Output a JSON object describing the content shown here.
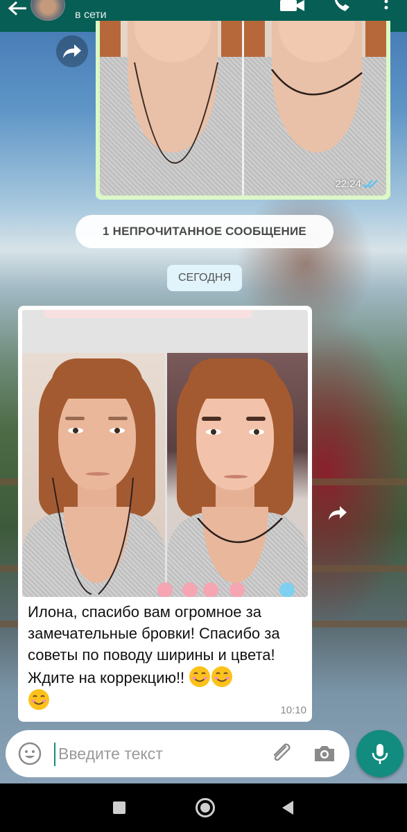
{
  "header": {
    "status": "в сети"
  },
  "messages": {
    "outgoing_image": {
      "time": "22:24",
      "read": true
    },
    "unread_banner": "1 НЕПРОЧИТАННОЕ СООБЩЕНИЕ",
    "date_chip": "СЕГОДНЯ",
    "incoming": {
      "text": "Илона, спасибо вам огромное за замечательные бровки! Спасибо за советы по поводу ширины и цвета! Ждите на коррекцию!!",
      "emojis": [
        "smiling-face-emoji",
        "smiling-face-emoji",
        "smiling-face-emoji"
      ],
      "time": "10:10"
    }
  },
  "composer": {
    "placeholder": "Введите текст",
    "icons": [
      "emoji-icon",
      "paperclip-icon",
      "camera-icon",
      "microphone-icon"
    ]
  },
  "colors": {
    "header_bg": "#075e54",
    "outgoing_bubble": "#dcf8c6",
    "accent": "#128c7e",
    "read_ticks": "#4fc3f7"
  }
}
